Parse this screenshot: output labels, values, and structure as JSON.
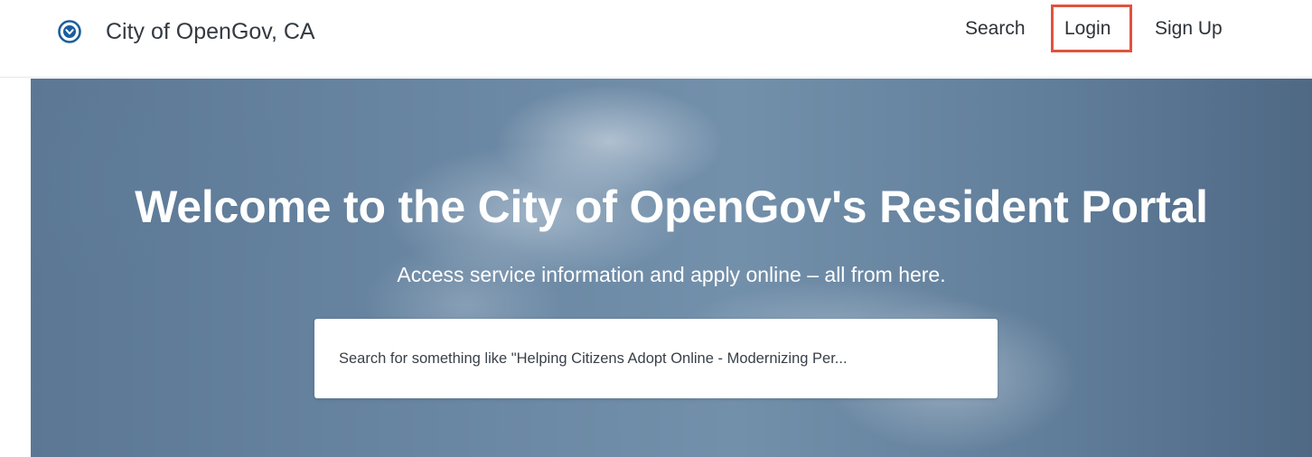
{
  "header": {
    "logo_icon": "opengov-chevron-circle-icon",
    "brand_name": "City of OpenGov, CA",
    "nav": {
      "search_label": "Search",
      "login_label": "Login",
      "signup_label": "Sign Up"
    }
  },
  "hero": {
    "title": "Welcome to the City of OpenGov's Resident Portal",
    "subtitle": "Access service information and apply online – all from here.",
    "search_placeholder": "Search for something like \"Helping Citizens Adopt Online - Modernizing Per..."
  },
  "colors": {
    "brand_blue": "#1b5e9e",
    "highlight_red": "#e0533e",
    "hero_blue": "#6a87a3"
  }
}
